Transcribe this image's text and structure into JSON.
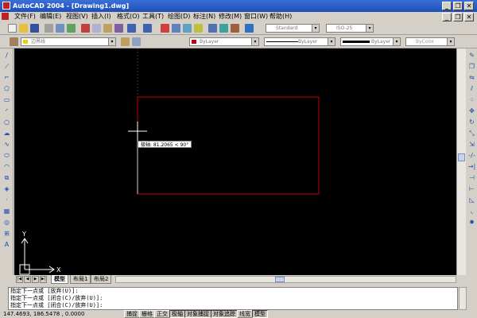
{
  "window": {
    "title": "AutoCAD 2004 - [Drawing1.dwg]",
    "min_glyph": "_",
    "restore_glyph": "❐",
    "close_glyph": "✕"
  },
  "menu": [
    {
      "label": "文件(F)"
    },
    {
      "label": "编辑(E)"
    },
    {
      "label": "视图(V)"
    },
    {
      "label": "插入(I)"
    },
    {
      "label": "格式(O)"
    },
    {
      "label": "工具(T)"
    },
    {
      "label": "绘图(D)"
    },
    {
      "label": "标注(N)"
    },
    {
      "label": "修改(M)"
    },
    {
      "label": "窗口(W)"
    },
    {
      "label": "帮助(H)"
    }
  ],
  "styles": {
    "text_style": "Standard",
    "dim_style": "ISO-25"
  },
  "properties": {
    "layer": "边界线",
    "color": "ByLayer",
    "linetype": "ByLayer",
    "lineweight": "ByLayer",
    "plot_style": "ByColor",
    "dropdown_glyph": "▾"
  },
  "canvas": {
    "tooltip": "极轴: 81.2065 < 90°",
    "ucs_x": "X",
    "ucs_y": "Y"
  },
  "layout_tabs": [
    {
      "label": "模型",
      "active": true
    },
    {
      "label": "布局1",
      "active": false
    },
    {
      "label": "布局2",
      "active": false
    }
  ],
  "command_lines": [
    "指定下一点或 [放弃(U)]:",
    "指定下一点或 [闭合(C)/放弃(U)]:",
    "指定下一点或 [闭合(C)/放弃(U)]:"
  ],
  "status": {
    "coords": "147.4693, 186.5478 , 0.0000",
    "toggles": [
      {
        "label": "捕捉",
        "on": false
      },
      {
        "label": "栅格",
        "on": false
      },
      {
        "label": "正交",
        "on": false
      },
      {
        "label": "极轴",
        "on": true
      },
      {
        "label": "对象捕捉",
        "on": true
      },
      {
        "label": "对象追踪",
        "on": true
      },
      {
        "label": "线宽",
        "on": false
      },
      {
        "label": "模型",
        "on": true
      }
    ]
  },
  "colors": {
    "rectangle": "#c00000",
    "canvas_bg": "#000000",
    "title_bar": "#1e4fb8"
  },
  "icons": {
    "left_toolbar": [
      "line-icon",
      "construction-line-icon",
      "polyline-icon",
      "polygon-icon",
      "rectangle-icon",
      "arc-icon",
      "circle-icon",
      "revision-cloud-icon",
      "spline-icon",
      "ellipse-icon",
      "ellipse-arc-icon",
      "insert-block-icon",
      "make-block-icon",
      "point-icon",
      "hatch-icon",
      "region-icon",
      "table-icon",
      "multiline-text-icon"
    ],
    "right_toolbar": [
      "erase-icon",
      "copy-icon",
      "mirror-icon",
      "offset-icon",
      "array-icon",
      "move-icon",
      "rotate-icon",
      "scale-icon",
      "stretch-icon",
      "trim-icon",
      "extend-icon",
      "break-icon",
      "join-icon",
      "chamfer-icon",
      "fillet-icon",
      "explode-icon"
    ]
  }
}
